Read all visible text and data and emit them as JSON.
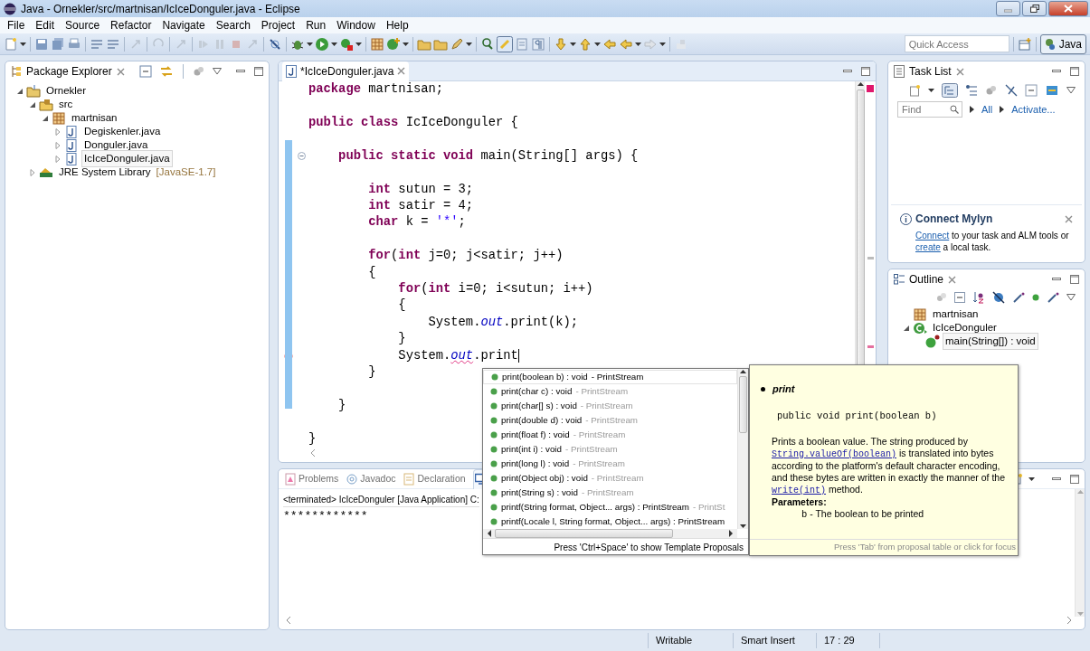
{
  "window": {
    "title": "Java - Ornekler/src/martnisan/IcIceDonguler.java - Eclipse"
  },
  "menu": [
    "File",
    "Edit",
    "Source",
    "Refactor",
    "Navigate",
    "Search",
    "Project",
    "Run",
    "Window",
    "Help"
  ],
  "quick_access": {
    "placeholder": "Quick Access"
  },
  "perspective": {
    "label": "Java",
    "selected": true
  },
  "package_explorer": {
    "title": "Package Explorer",
    "tree": [
      {
        "label": "Ornekler",
        "kind": "project",
        "expanded": true,
        "selected": false,
        "children": [
          {
            "label": "src",
            "kind": "source-folder",
            "expanded": true,
            "selected": false,
            "children": [
              {
                "label": "martnisan",
                "kind": "package",
                "expanded": true,
                "selected": false,
                "children": [
                  {
                    "label": "Degiskenler.java",
                    "kind": "java-file",
                    "expanded": false,
                    "selected": false
                  },
                  {
                    "label": "Donguler.java",
                    "kind": "java-file",
                    "expanded": false,
                    "selected": false
                  },
                  {
                    "label": "IcIceDonguler.java",
                    "kind": "java-file",
                    "expanded": false,
                    "selected": true
                  }
                ]
              }
            ]
          },
          {
            "label": "JRE System Library",
            "decoration": "[JavaSE-1.7]",
            "kind": "library",
            "expanded": false,
            "selected": false
          }
        ]
      }
    ]
  },
  "editor": {
    "tabs": [
      {
        "label": "*IcIceDonguler.java",
        "selected": true
      }
    ],
    "lines": [
      {
        "segments": [
          {
            "text": "package",
            "kind": "keyword"
          },
          {
            "text": " martnisan;"
          }
        ]
      },
      {
        "kind": "blank"
      },
      {
        "segments": [
          {
            "text": "public class",
            "kind": "keyword"
          },
          {
            "text": " IcIceDonguler {"
          }
        ]
      },
      {
        "kind": "blank"
      },
      {
        "foldable": true,
        "segments": [
          {
            "text": "    public static void",
            "kind": "keyword"
          },
          {
            "text": " main(String[] args) {"
          }
        ]
      },
      {
        "kind": "blank"
      },
      {
        "segments": [
          {
            "text": "        int",
            "kind": "keyword"
          },
          {
            "text": " sutun = 3;"
          }
        ]
      },
      {
        "segments": [
          {
            "text": "        int",
            "kind": "keyword"
          },
          {
            "text": " satir = 4;"
          }
        ]
      },
      {
        "segments": [
          {
            "text": "        char",
            "kind": "keyword"
          },
          {
            "text": " k = "
          },
          {
            "text": "'*'",
            "kind": "string"
          },
          {
            "text": ";"
          }
        ]
      },
      {
        "kind": "blank"
      },
      {
        "segments": [
          {
            "text": "        for",
            "kind": "keyword"
          },
          {
            "text": "("
          },
          {
            "text": "int",
            "kind": "keyword"
          },
          {
            "text": " j=0; j<satir; j++)"
          }
        ]
      },
      {
        "segments": [
          {
            "text": "        {"
          }
        ]
      },
      {
        "segments": [
          {
            "text": "            for",
            "kind": "keyword"
          },
          {
            "text": "("
          },
          {
            "text": "int",
            "kind": "keyword"
          },
          {
            "text": " i=0; i<sutun; i++)"
          }
        ]
      },
      {
        "segments": [
          {
            "text": "            {"
          }
        ]
      },
      {
        "segments": [
          {
            "text": "                System."
          },
          {
            "text": "out",
            "kind": "field"
          },
          {
            "text": ".print(k);"
          }
        ]
      },
      {
        "segments": [
          {
            "text": "            }"
          }
        ]
      },
      {
        "error": true,
        "cursor": true,
        "segments": [
          {
            "text": "            System."
          },
          {
            "text": "out",
            "kind": "field",
            "error": true
          },
          {
            "text": ".print"
          }
        ]
      },
      {
        "segments": [
          {
            "text": "        }"
          }
        ]
      },
      {
        "kind": "blank"
      },
      {
        "segments": [
          {
            "text": "    }"
          }
        ]
      },
      {
        "kind": "blank"
      },
      {
        "segments": [
          {
            "text": "}"
          }
        ]
      }
    ]
  },
  "task_list": {
    "title": "Task List",
    "find": {
      "placeholder": "Find"
    },
    "links": [
      "All",
      "Activate..."
    ],
    "mylyn": {
      "title": "Connect Mylyn",
      "segments": [
        {
          "text": "Connect",
          "kind": "link"
        },
        {
          "text": " to your task and ALM tools or "
        },
        {
          "text": "create",
          "kind": "link"
        },
        {
          "text": " a local task."
        }
      ]
    }
  },
  "outline": {
    "title": "Outline",
    "tree": [
      {
        "label": "martnisan",
        "kind": "package",
        "selected": false
      },
      {
        "label": "IcIceDonguler",
        "kind": "class",
        "expanded": true,
        "selected": false,
        "children": [
          {
            "label": "main(String[]) : void",
            "kind": "method",
            "selected": true
          }
        ]
      }
    ]
  },
  "bottom_panel": {
    "tabs": [
      {
        "label": "Problems",
        "kind": "problems",
        "selected": false
      },
      {
        "label": "Javadoc",
        "kind": "javadoc",
        "selected": false
      },
      {
        "label": "Declaration",
        "kind": "declaration",
        "selected": false
      },
      {
        "kind": "console",
        "selected": true
      }
    ],
    "console_header": "<terminated> IcIceDonguler [Java Application] C:",
    "console_output": "************"
  },
  "completion": {
    "proposals": [
      {
        "signature": "print(boolean b) : void",
        "qualifier": "- PrintStream",
        "selected": true
      },
      {
        "signature": "print(char c) : void",
        "qualifier": "- PrintStream",
        "selected": false
      },
      {
        "signature": "print(char[] s) : void",
        "qualifier": "- PrintStream",
        "selected": false
      },
      {
        "signature": "print(double d) : void",
        "qualifier": "- PrintStream",
        "selected": false
      },
      {
        "signature": "print(float f) : void",
        "qualifier": "- PrintStream",
        "selected": false
      },
      {
        "signature": "print(int i) : void",
        "qualifier": "- PrintStream",
        "selected": false
      },
      {
        "signature": "print(long l) : void",
        "qualifier": "- PrintStream",
        "selected": false
      },
      {
        "signature": "print(Object obj) : void",
        "qualifier": "- PrintStream",
        "selected": false
      },
      {
        "signature": "print(String s) : void",
        "qualifier": "- PrintStream",
        "selected": false
      },
      {
        "signature": "printf(String format, Object... args) : PrintStream",
        "qualifier": "- PrintSt",
        "selected": false
      },
      {
        "signature": "printf(Locale l, String format, Object... args) : PrintStream",
        "selected": false
      }
    ],
    "footer": "Press 'Ctrl+Space' to show Template Proposals"
  },
  "javadoc_popup": {
    "title": "print",
    "signature": "public void print(boolean b)",
    "description": [
      {
        "text": "Prints a boolean value. The string produced by "
      },
      {
        "text": "String.valueOf(boolean)",
        "kind": "link"
      },
      {
        "text": " is translated into bytes according to the platform's default character encoding, and these bytes are written in exactly the manner of the "
      },
      {
        "text": "write(int)",
        "kind": "link"
      },
      {
        "text": " method."
      }
    ],
    "parameters_label": "Parameters:",
    "parameters": [
      {
        "name": "b",
        "text": " - The boolean to be printed"
      }
    ],
    "footer": "Press 'Tab' from proposal table or click for focus"
  },
  "status_bar": [
    "Writable",
    "Smart Insert",
    "17 : 29"
  ]
}
